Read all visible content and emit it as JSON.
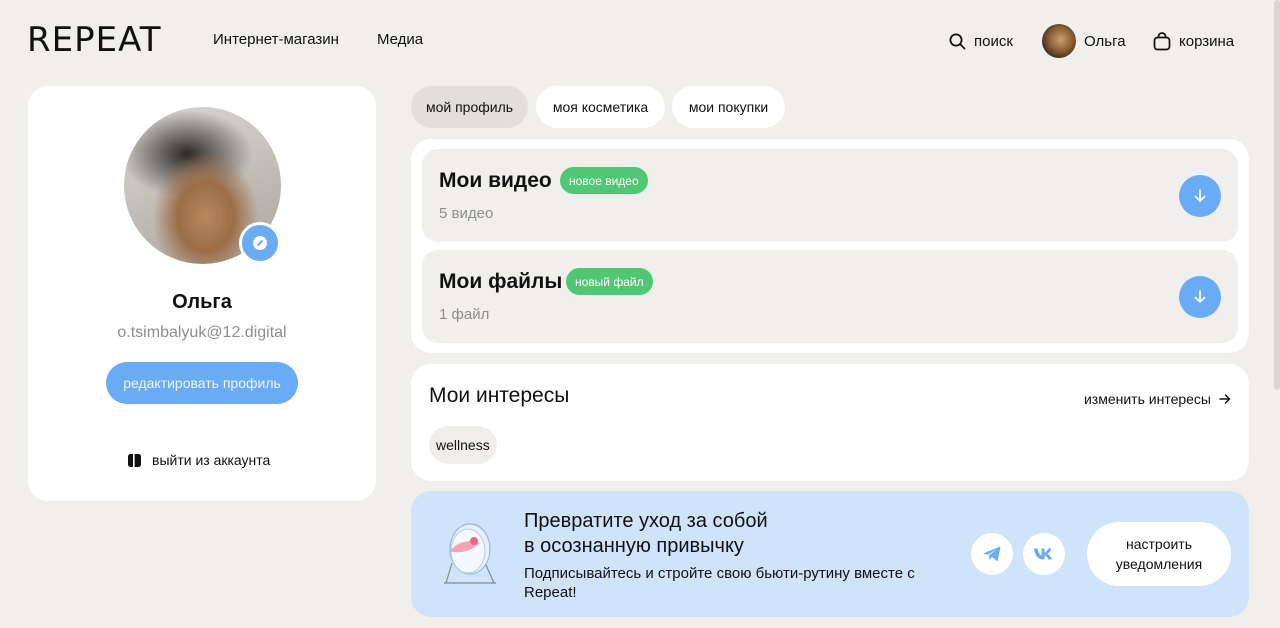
{
  "header": {
    "logo": "REPEAT",
    "nav": [
      "Интернет-магазин",
      "Медиа"
    ],
    "search_label": "поиск",
    "user_name": "Ольга",
    "cart_label": "корзина"
  },
  "profile": {
    "name": "Ольга",
    "email": "o.tsimbalyuk@12.digital",
    "edit_label": "редактировать профиль",
    "logout_label": "выйти из аккаунта"
  },
  "tabs": [
    {
      "label": "мой профиль",
      "active": true
    },
    {
      "label": "моя косметика",
      "active": false
    },
    {
      "label": "мои покупки",
      "active": false
    }
  ],
  "media": {
    "videos": {
      "title": "Мои видео",
      "badge": "новое видео",
      "count": "5 видео"
    },
    "files": {
      "title": "Мои файлы",
      "badge": "новый файл",
      "count": "1 файл"
    }
  },
  "interests": {
    "title": "Мои интересы",
    "change_label": "изменить интересы",
    "tags": [
      "wellness"
    ]
  },
  "banner": {
    "title_line1": "Превратите уход за собой",
    "title_line2": "в осознанную привычку",
    "text": "Подписывайтесь и стройте свою бьюти-рутину вместе с Repeat!",
    "notify_label": "настроить уведомления",
    "socials": [
      "telegram-icon",
      "vk-icon"
    ]
  },
  "colors": {
    "accent": "#69abf5",
    "badge": "#4fc774",
    "background": "#f1efec",
    "banner": "#cfe3fb"
  }
}
